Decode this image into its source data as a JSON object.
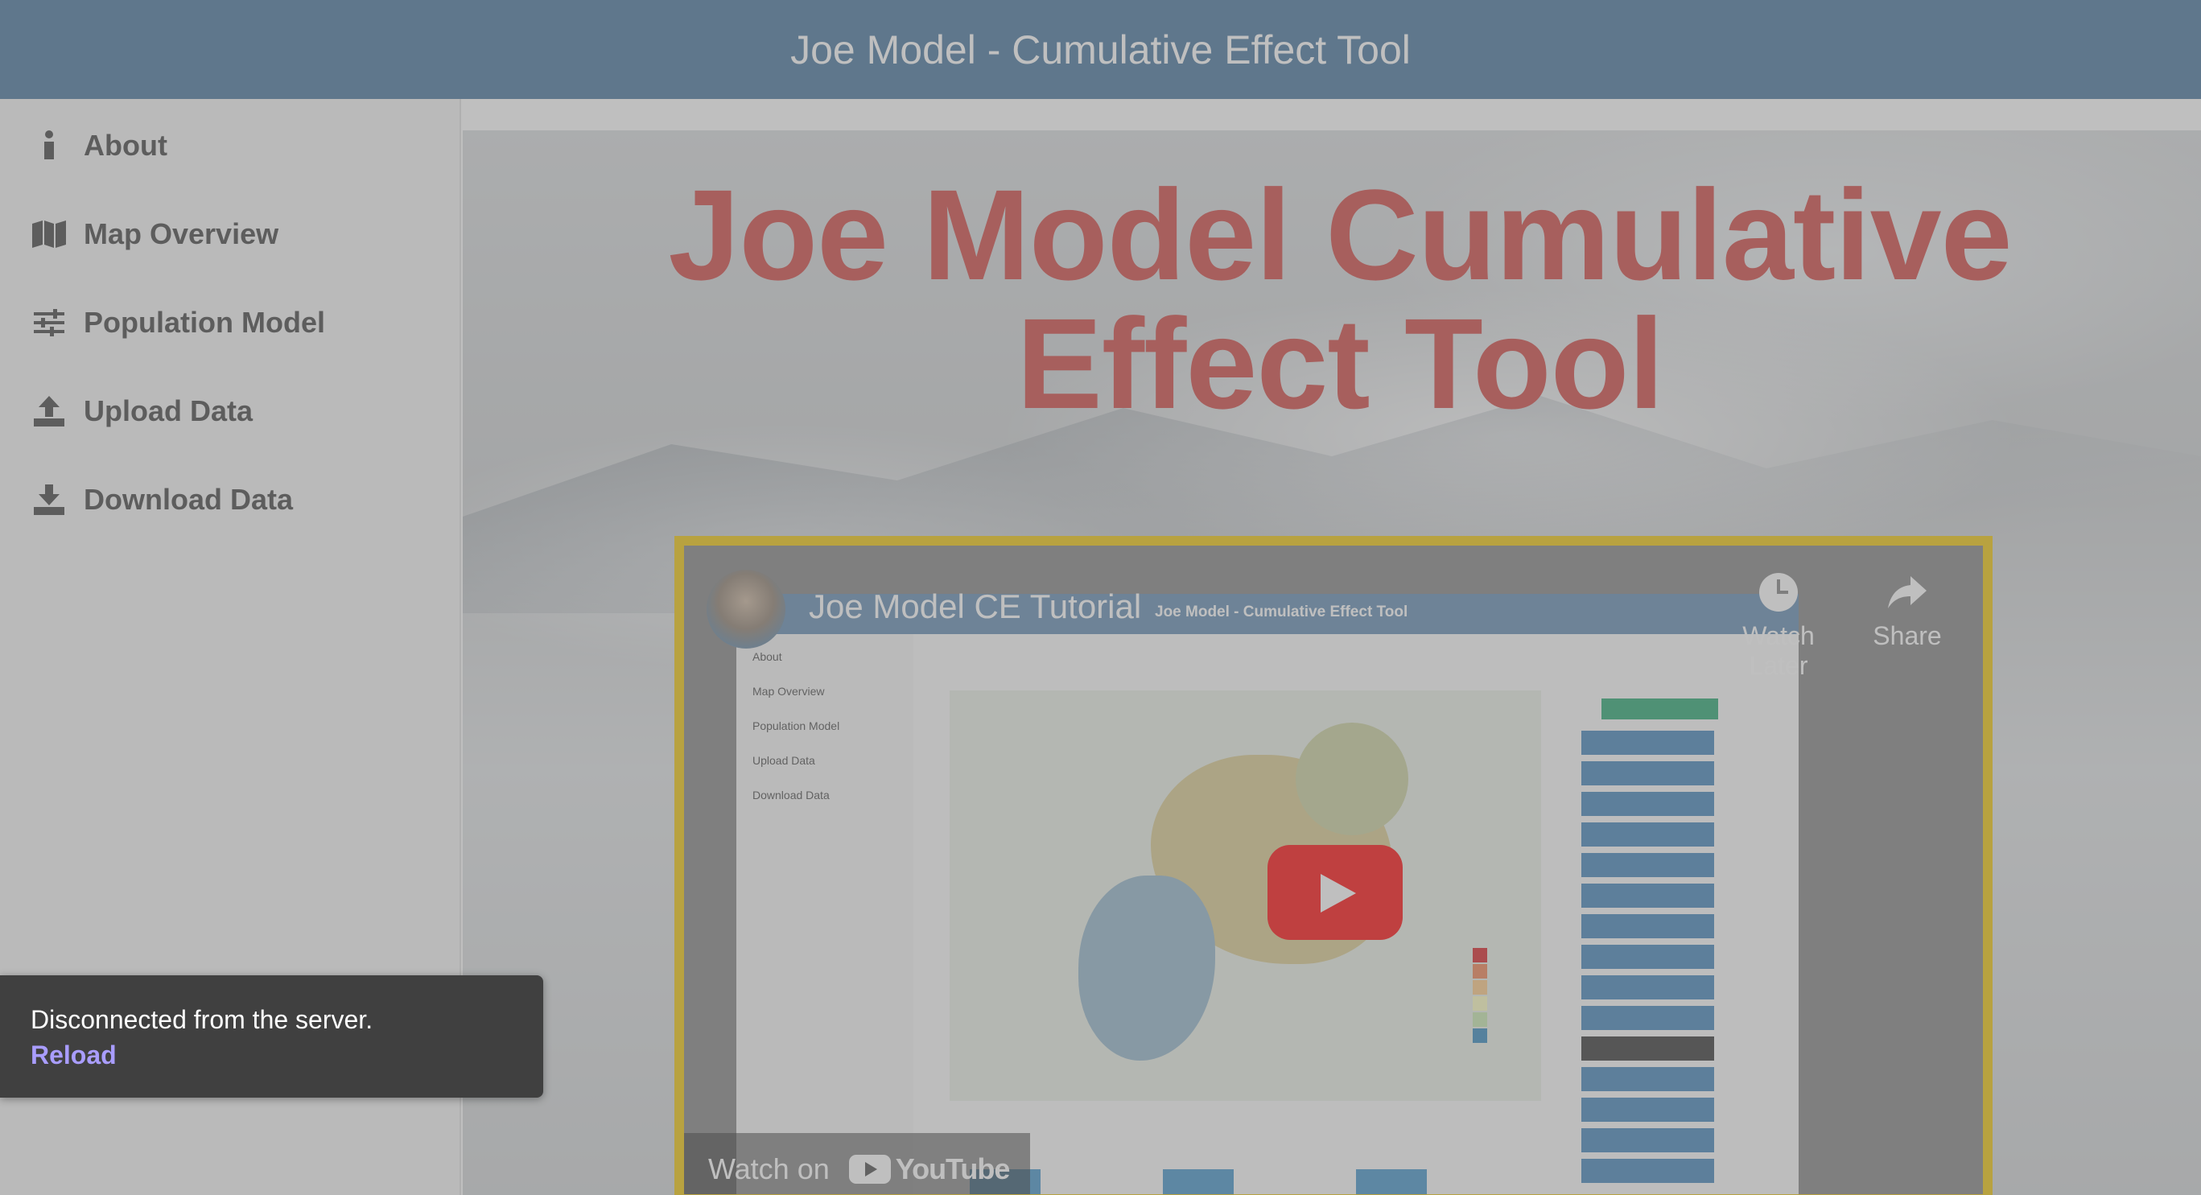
{
  "header": {
    "title": "Joe Model - Cumulative Effect Tool"
  },
  "sidebar": {
    "items": [
      {
        "label": "About",
        "icon": "info-icon"
      },
      {
        "label": "Map Overview",
        "icon": "map-icon"
      },
      {
        "label": "Population Model",
        "icon": "sliders-icon"
      },
      {
        "label": "Upload Data",
        "icon": "upload-icon"
      },
      {
        "label": "Download Data",
        "icon": "download-icon"
      }
    ]
  },
  "main": {
    "hero_title": "Joe Model Cumulative Effect Tool",
    "video": {
      "title": "Joe Model CE Tutorial",
      "watch_later": "Watch Later",
      "share": "Share",
      "watch_on": "Watch on",
      "youtube_word": "YouTube",
      "thumb": {
        "bar_title": "Joe Model - Cumulative Effect Tool",
        "nav": [
          "About",
          "Map Overview",
          "Population Model",
          "Upload Data",
          "Download Data"
        ]
      }
    }
  },
  "toast": {
    "message": "Disconnected from the server.",
    "action": "Reload"
  },
  "colors": {
    "header_bg": "#3f6f98",
    "hero_title": "#cf3f3a",
    "toast_bg": "#404040",
    "toast_link": "#a99dff",
    "video_border": "#f0c400"
  }
}
